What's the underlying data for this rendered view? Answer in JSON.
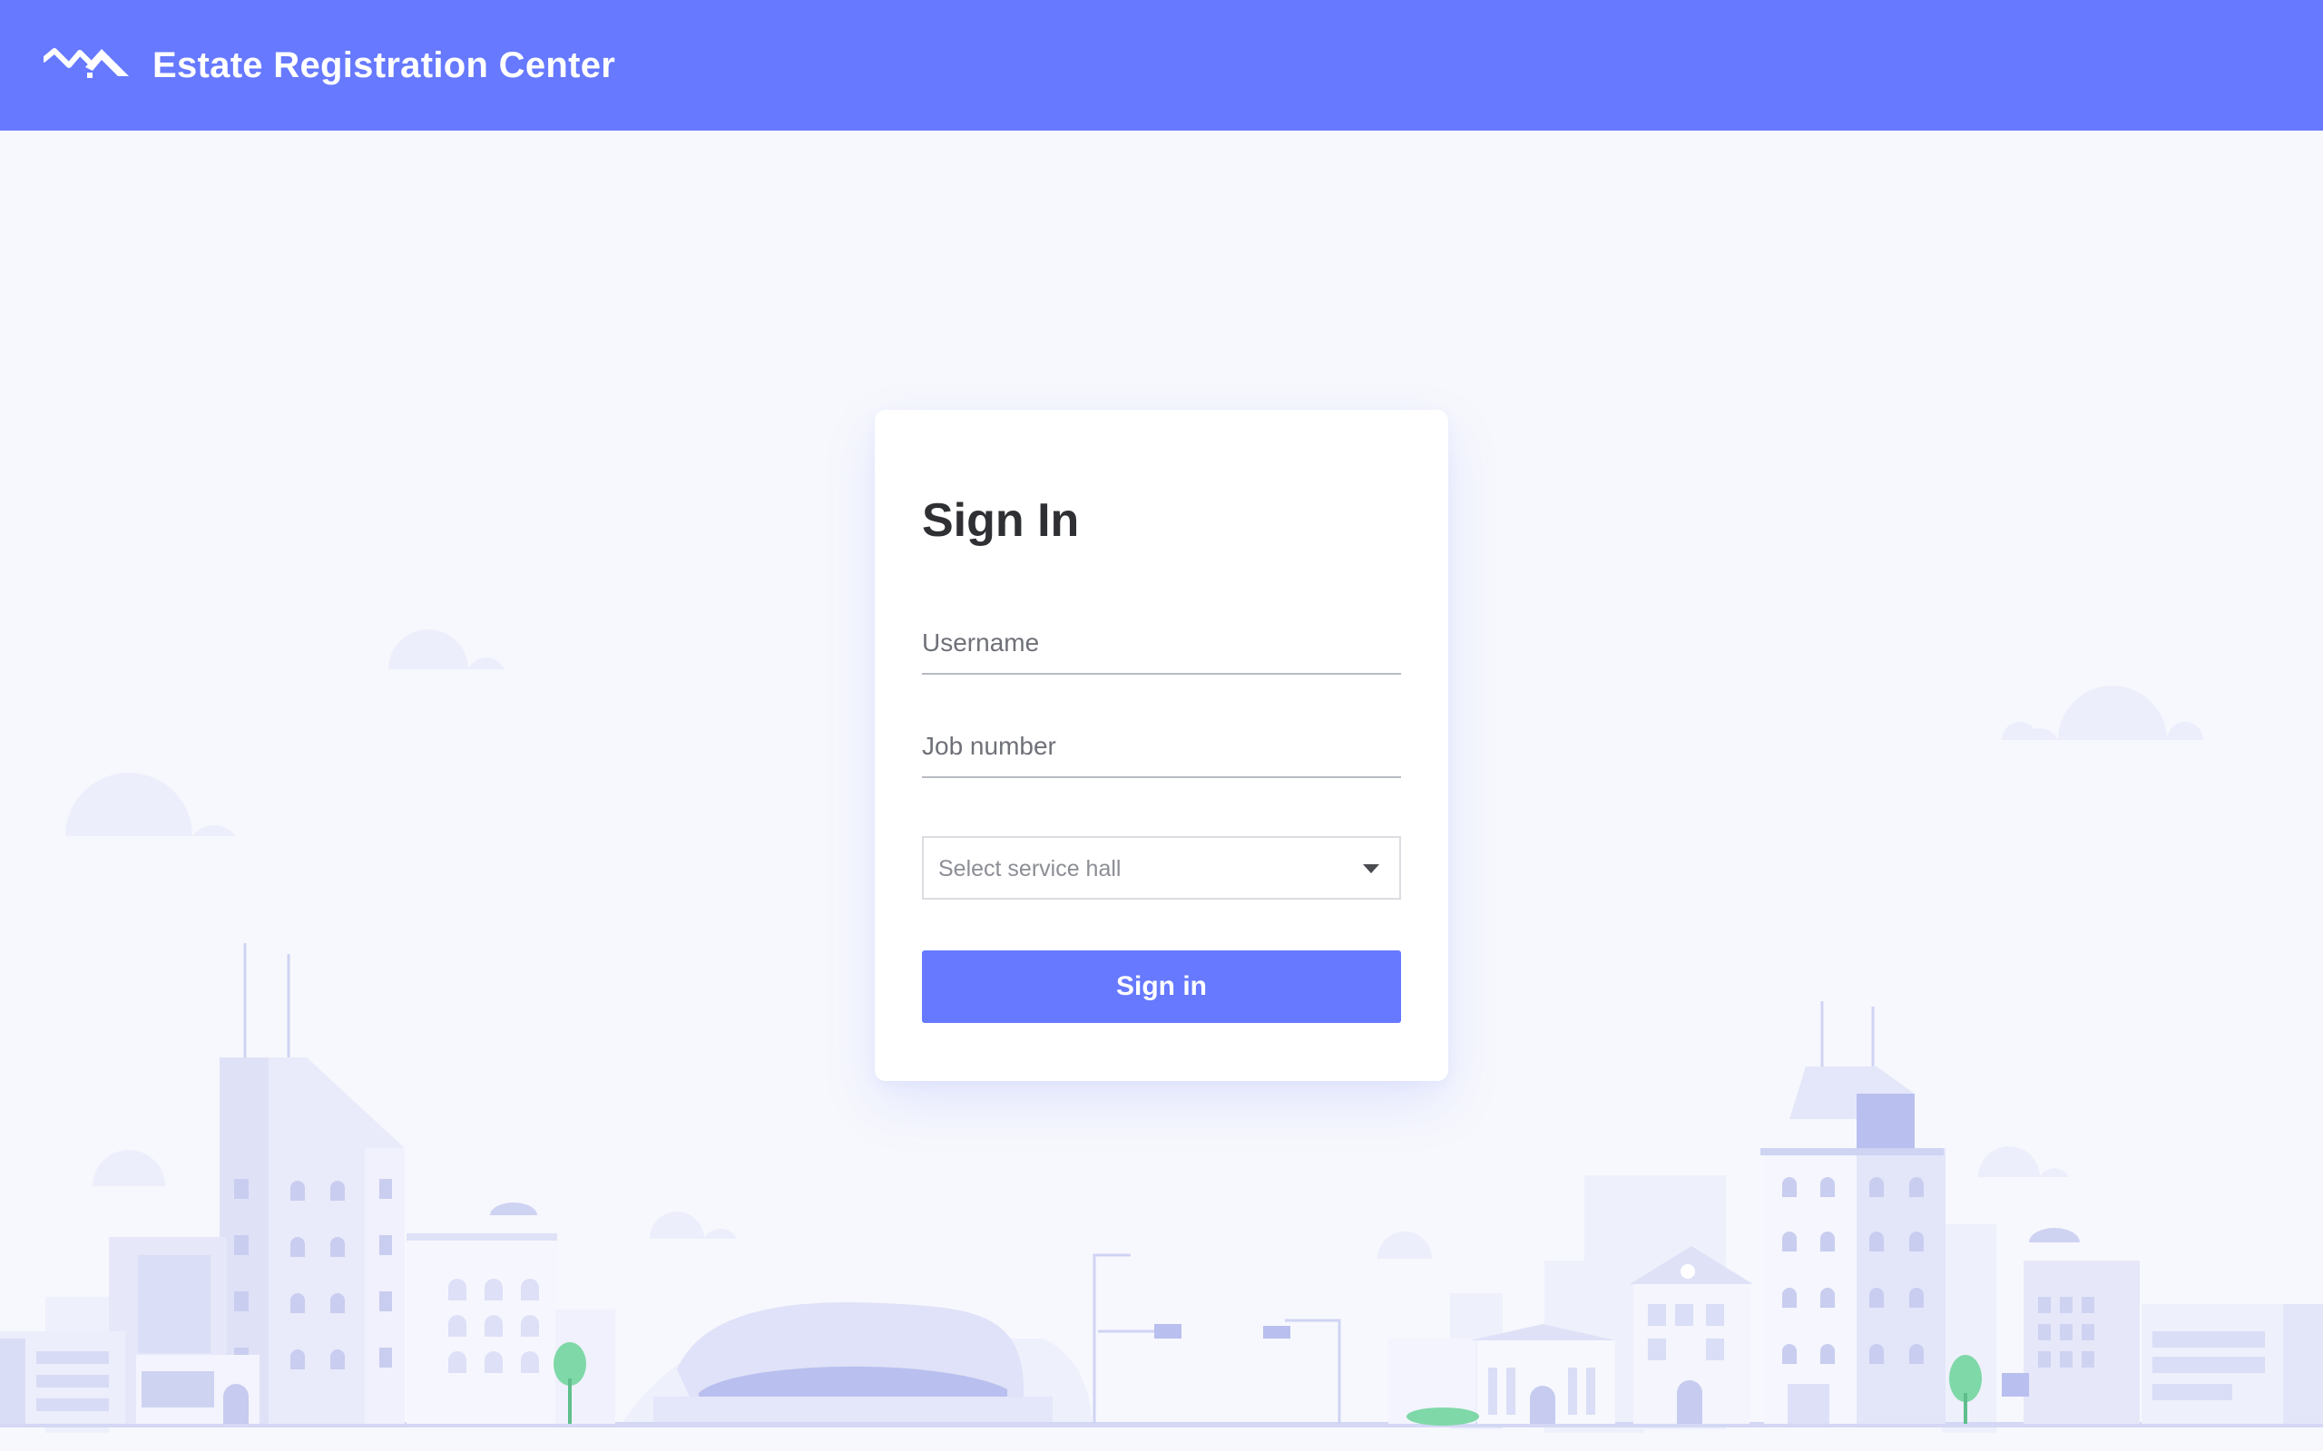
{
  "colors": {
    "brand": "#6679ff",
    "page_background": "#f7f8fd",
    "card_background": "#ffffff",
    "title_text": "#2f3033"
  },
  "header": {
    "logo_icon": "mountain-logo-icon",
    "title": "Estate Registration Center"
  },
  "login": {
    "title": "Sign In",
    "username": {
      "placeholder": "Username",
      "value": ""
    },
    "job_number": {
      "placeholder": "Job number",
      "value": ""
    },
    "service_hall": {
      "selected": "Select service hall",
      "icon": "caret-down-icon"
    },
    "submit_label": "Sign in"
  },
  "background": {
    "illustration": "city-skyline-illustration"
  }
}
